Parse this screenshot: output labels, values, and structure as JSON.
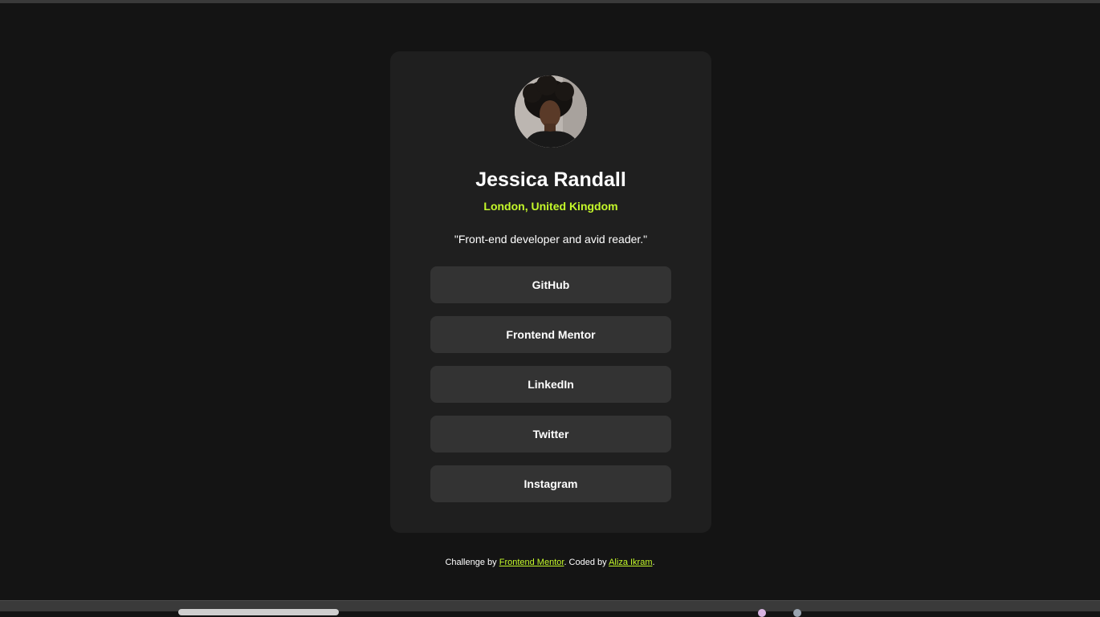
{
  "profile": {
    "avatar_alt": "Jessica Randall",
    "name": "Jessica Randall",
    "location": "London, United Kingdom",
    "bio": "\"Front-end developer and avid reader.\""
  },
  "links": [
    {
      "label": "GitHub"
    },
    {
      "label": "Frontend Mentor"
    },
    {
      "label": "LinkedIn"
    },
    {
      "label": "Twitter"
    },
    {
      "label": "Instagram"
    }
  ],
  "footer": {
    "prefix": "Challenge by ",
    "challenge_link": "Frontend Mentor",
    "middle": ". Coded by ",
    "author_link": "Aliza Ikram",
    "suffix": "."
  },
  "colors": {
    "page_bg": "#141414",
    "card_bg": "#1f1f1f",
    "button_bg": "#333333",
    "accent": "#c4f82a",
    "text": "#ffffff"
  },
  "icons": {
    "avatar": "profile-photo"
  }
}
